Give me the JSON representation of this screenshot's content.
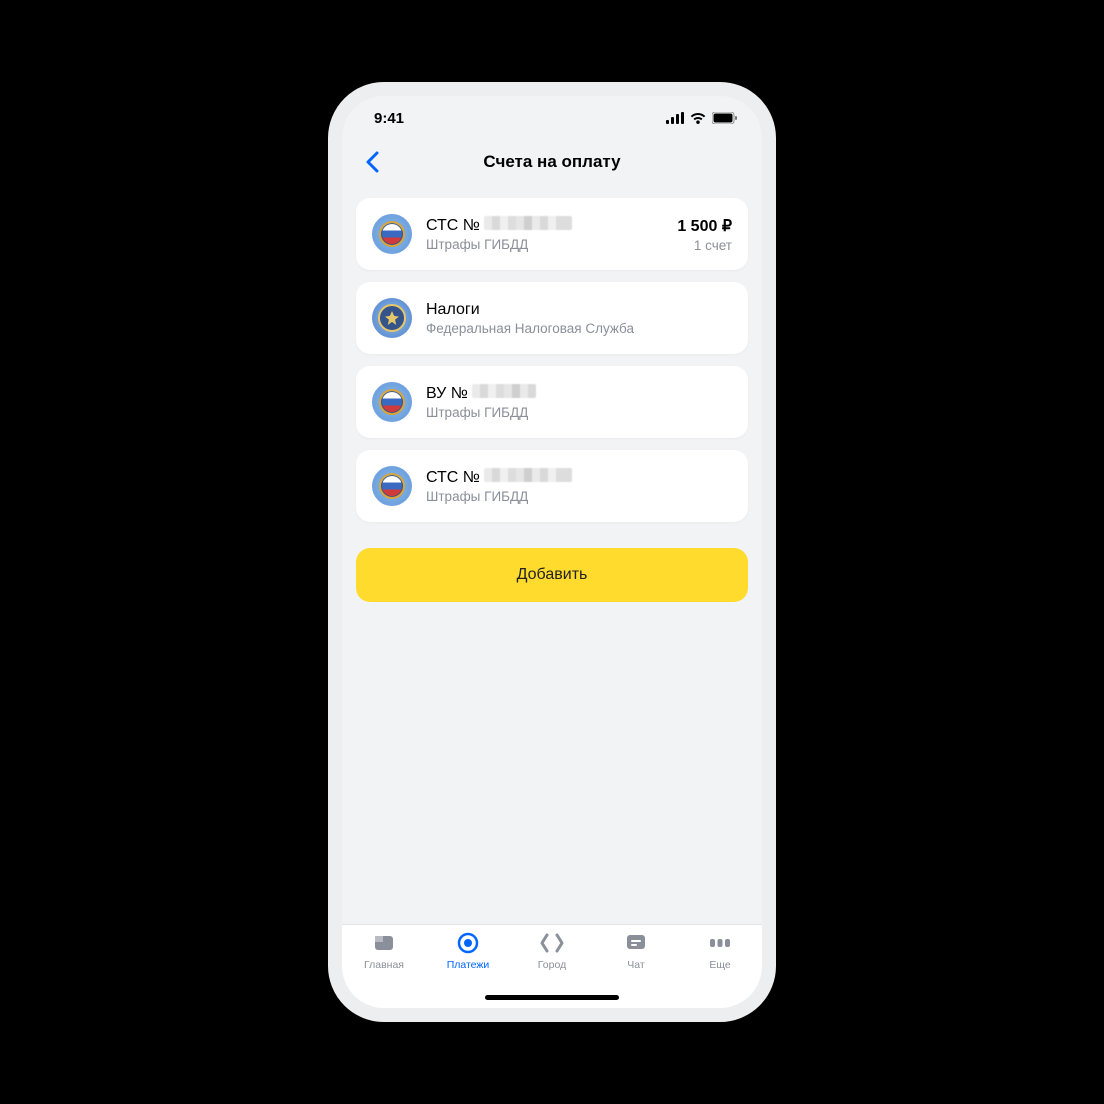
{
  "status": {
    "time": "9:41"
  },
  "nav": {
    "title": "Счета на оплату"
  },
  "cards": [
    {
      "prefix": "СТС №",
      "subtitle": "Штрафы ГИБДД",
      "amount": "1 500 ₽",
      "count": "1 счет",
      "redacted": true,
      "icon": "gibdd"
    },
    {
      "title": "Налоги",
      "subtitle": "Федеральная Налоговая Служба",
      "icon": "fns"
    },
    {
      "prefix": "ВУ №",
      "subtitle": "Штрафы ГИБДД",
      "redacted": true,
      "redacted_narrow": true,
      "icon": "gibdd"
    },
    {
      "prefix": "СТС №",
      "subtitle": "Штрафы ГИБДД",
      "redacted": true,
      "icon": "gibdd"
    }
  ],
  "add_button": "Добавить",
  "tabs": [
    {
      "label": "Главная"
    },
    {
      "label": "Платежи"
    },
    {
      "label": "Город"
    },
    {
      "label": "Чат"
    },
    {
      "label": "Еще"
    }
  ],
  "active_tab": 1
}
